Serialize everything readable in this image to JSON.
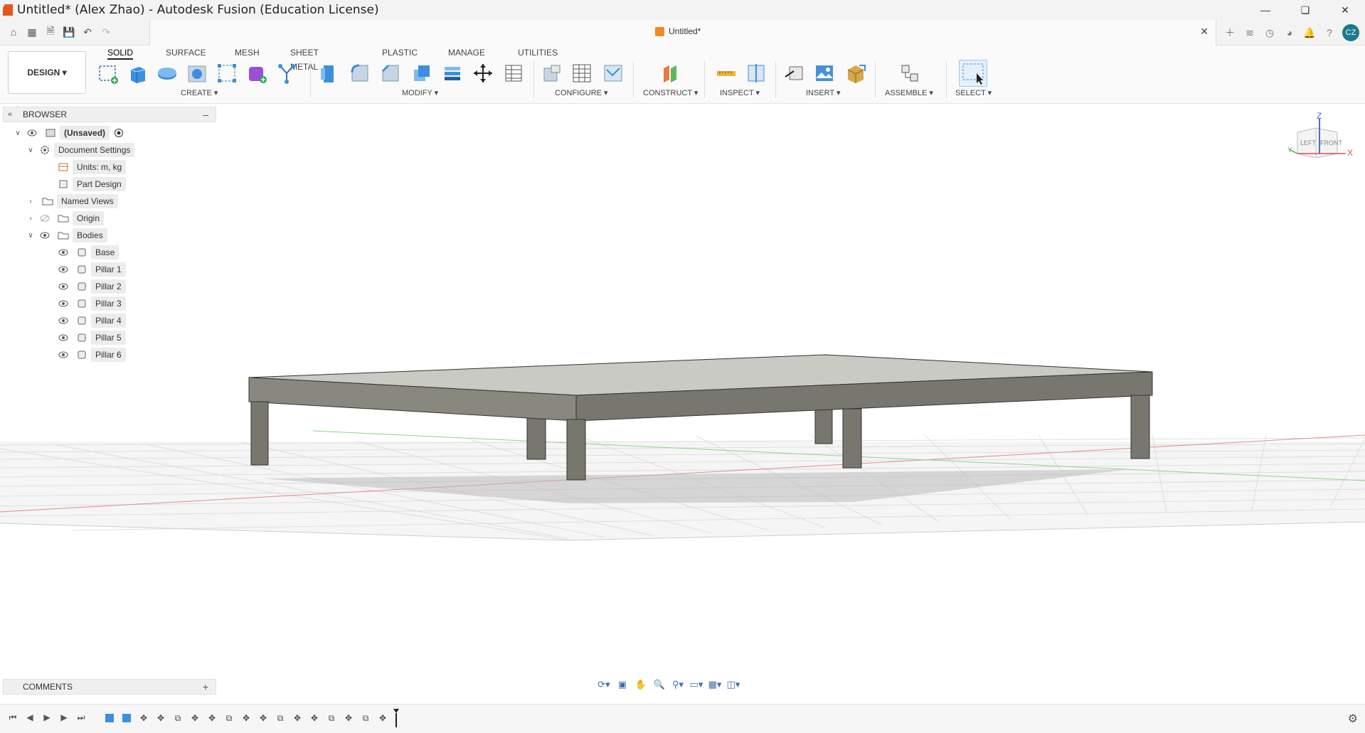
{
  "window": {
    "title": "Untitled* (Alex Zhao) - Autodesk Fusion (Education License)"
  },
  "doc_tab": {
    "title": "Untitled*"
  },
  "user": {
    "initials": "CZ"
  },
  "workspace": {
    "label": "DESIGN ▾"
  },
  "ribbon": {
    "tabs": [
      "SOLID",
      "SURFACE",
      "MESH",
      "SHEET METAL",
      "PLASTIC",
      "MANAGE",
      "UTILITIES"
    ],
    "active_tab": "SOLID",
    "groups": [
      "CREATE ▾",
      "MODIFY ▾",
      "CONFIGURE ▾",
      "CONSTRUCT ▾",
      "INSPECT ▾",
      "INSERT ▾",
      "ASSEMBLE ▾",
      "SELECT ▾"
    ]
  },
  "browser": {
    "title": "BROWSER",
    "root": "(Unsaved)",
    "document_settings": "Document Settings",
    "units": "Units: m, kg",
    "part_design": "Part Design",
    "named_views": "Named Views",
    "origin": "Origin",
    "bodies": "Bodies",
    "body_items": [
      "Base",
      "Pillar 1",
      "Pillar 2",
      "Pillar 3",
      "Pillar 4",
      "Pillar 5",
      "Pillar 6"
    ]
  },
  "comments": {
    "label": "COMMENTS"
  },
  "viewcube": {
    "z": "Z",
    "x": "X",
    "y": "Y",
    "left": "LEFT",
    "front": "FRONT"
  },
  "colors": {
    "accent": "#0696d7",
    "avatar": "#1c7a8c",
    "body_top": "#c9cac3",
    "body_side": "#77776f"
  },
  "icons": {
    "quick_access": [
      "home-icon",
      "grid-icon",
      "file-icon",
      "save-icon",
      "undo-icon",
      "redo-icon"
    ],
    "nav_bar": [
      "orbit-icon",
      "look-at-icon",
      "pan-icon",
      "zoom-icon",
      "fit-icon",
      "display-settings-icon",
      "grid-settings-icon",
      "viewports-icon"
    ]
  }
}
